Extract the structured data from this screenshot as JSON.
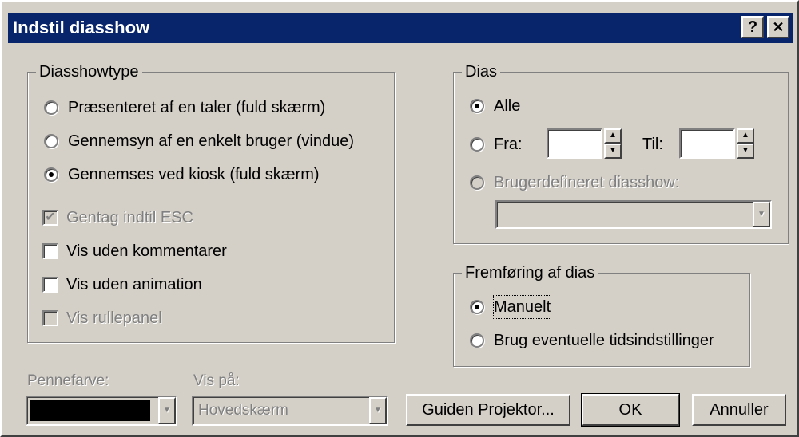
{
  "window": {
    "title": "Indstil diasshow",
    "help_glyph": "?",
    "close_glyph": "✕"
  },
  "diasshowtype": {
    "legend": "Diasshowtype",
    "radios": [
      {
        "label": "Præsenteret af en taler (fuld skærm)",
        "checked": false
      },
      {
        "label": "Gennemsyn af en enkelt bruger (vindue)",
        "checked": false
      },
      {
        "label": "Gennemses ved kiosk (fuld skærm)",
        "checked": true
      }
    ],
    "checks": [
      {
        "label": "Gentag indtil ESC",
        "checked": true,
        "disabled": true
      },
      {
        "label": "Vis uden kommentarer",
        "checked": false,
        "disabled": false
      },
      {
        "label": "Vis uden animation",
        "checked": false,
        "disabled": false
      },
      {
        "label": "Vis rullepanel",
        "checked": false,
        "disabled": true
      }
    ]
  },
  "dias": {
    "legend": "Dias",
    "alle": "Alle",
    "fra": "Fra:",
    "til": "Til:",
    "fra_value": "",
    "til_value": "",
    "brugerdefineret": "Brugerdefineret diasshow:",
    "custom_value": ""
  },
  "fremforing": {
    "legend": "Fremføring af dias",
    "manuelt": "Manuelt",
    "tids": "Brug eventuelle tidsindstillinger"
  },
  "bottom": {
    "pennefarve_label": "Pennefarve:",
    "pen_color": "#000000",
    "vis_paa_label": "Vis på:",
    "vis_paa_value": "Hovedskærm",
    "guiden": "Guiden Projektor...",
    "ok": "OK",
    "annuller": "Annuller"
  },
  "icons": {
    "dropdown": "dropdown-arrow-icon",
    "spin_up": "▲",
    "spin_down": "▼",
    "checkmark": "✔"
  }
}
